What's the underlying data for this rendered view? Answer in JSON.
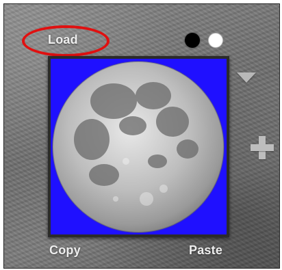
{
  "buttons": {
    "load_label": "Load",
    "copy_label": "Copy",
    "paste_label": "Paste"
  },
  "image_panel": {
    "background_color": "#1f10ff",
    "content_icon": "moon-image"
  },
  "color_swatches": [
    {
      "name": "black",
      "color": "#000000"
    },
    {
      "name": "white",
      "color": "#ffffff"
    }
  ],
  "icons": {
    "dropdown": "triangle-down-icon",
    "add": "plus-icon"
  },
  "annotation": {
    "highlight_color": "#e01010",
    "highlight_target": "load-button"
  }
}
